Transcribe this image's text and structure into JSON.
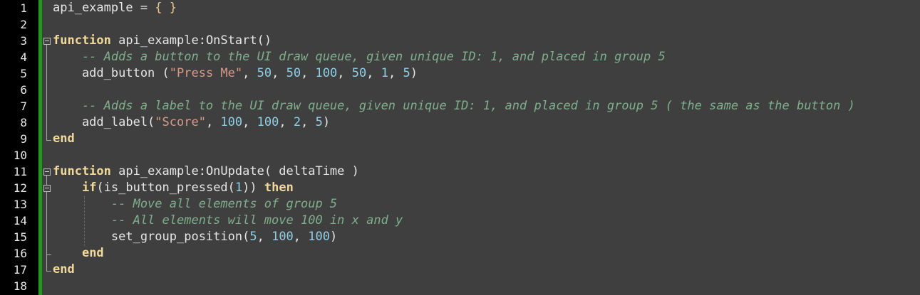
{
  "editor": {
    "lines": [
      {
        "number": "1",
        "tokens": [
          {
            "t": "id",
            "v": "api_example = "
          },
          {
            "t": "brace",
            "v": "{ }"
          }
        ]
      },
      {
        "number": "2",
        "tokens": []
      },
      {
        "number": "3",
        "tokens": [
          {
            "t": "kw",
            "v": "function"
          },
          {
            "t": "id",
            "v": " api_example:OnStart()"
          }
        ]
      },
      {
        "number": "4",
        "tokens": [
          {
            "t": "cm",
            "v": "    -- Adds a button to the UI draw queue, given unique ID: 1, and placed in group 5"
          }
        ]
      },
      {
        "number": "5",
        "tokens": [
          {
            "t": "id",
            "v": "    add_button ("
          },
          {
            "t": "st",
            "v": "\"Press Me\""
          },
          {
            "t": "id",
            "v": ", "
          },
          {
            "t": "nm",
            "v": "50"
          },
          {
            "t": "id",
            "v": ", "
          },
          {
            "t": "nm",
            "v": "50"
          },
          {
            "t": "id",
            "v": ", "
          },
          {
            "t": "nm",
            "v": "100"
          },
          {
            "t": "id",
            "v": ", "
          },
          {
            "t": "nm",
            "v": "50"
          },
          {
            "t": "id",
            "v": ", "
          },
          {
            "t": "nm",
            "v": "1"
          },
          {
            "t": "id",
            "v": ", "
          },
          {
            "t": "nm",
            "v": "5"
          },
          {
            "t": "id",
            "v": ")"
          }
        ]
      },
      {
        "number": "6",
        "tokens": []
      },
      {
        "number": "7",
        "tokens": [
          {
            "t": "cm",
            "v": "    -- Adds a label to the UI draw queue, given unique ID: 1, and placed in group 5 ( the same as the button )"
          }
        ]
      },
      {
        "number": "8",
        "tokens": [
          {
            "t": "id",
            "v": "    add_label("
          },
          {
            "t": "st",
            "v": "\"Score\""
          },
          {
            "t": "id",
            "v": ", "
          },
          {
            "t": "nm",
            "v": "100"
          },
          {
            "t": "id",
            "v": ", "
          },
          {
            "t": "nm",
            "v": "100"
          },
          {
            "t": "id",
            "v": ", "
          },
          {
            "t": "nm",
            "v": "2"
          },
          {
            "t": "id",
            "v": ", "
          },
          {
            "t": "nm",
            "v": "5"
          },
          {
            "t": "id",
            "v": ")"
          }
        ]
      },
      {
        "number": "9",
        "tokens": [
          {
            "t": "kw",
            "v": "end"
          }
        ]
      },
      {
        "number": "10",
        "tokens": []
      },
      {
        "number": "11",
        "tokens": [
          {
            "t": "kw",
            "v": "function"
          },
          {
            "t": "id",
            "v": " api_example:OnUpdate( deltaTime )"
          }
        ]
      },
      {
        "number": "12",
        "tokens": [
          {
            "t": "id",
            "v": "    "
          },
          {
            "t": "kw",
            "v": "if"
          },
          {
            "t": "id",
            "v": "(is_button_pressed("
          },
          {
            "t": "nm",
            "v": "1"
          },
          {
            "t": "id",
            "v": ")) "
          },
          {
            "t": "kw",
            "v": "then"
          }
        ]
      },
      {
        "number": "13",
        "tokens": [
          {
            "t": "cm",
            "v": "        -- Move all elements of group 5"
          }
        ]
      },
      {
        "number": "14",
        "tokens": [
          {
            "t": "cm",
            "v": "        -- All elements will move 100 in x and y"
          }
        ]
      },
      {
        "number": "15",
        "tokens": [
          {
            "t": "id",
            "v": "        set_group_position("
          },
          {
            "t": "nm",
            "v": "5"
          },
          {
            "t": "id",
            "v": ", "
          },
          {
            "t": "nm",
            "v": "100"
          },
          {
            "t": "id",
            "v": ", "
          },
          {
            "t": "nm",
            "v": "100"
          },
          {
            "t": "id",
            "v": ")"
          }
        ]
      },
      {
        "number": "16",
        "tokens": [
          {
            "t": "id",
            "v": "    "
          },
          {
            "t": "kw",
            "v": "end"
          }
        ]
      },
      {
        "number": "17",
        "tokens": [
          {
            "t": "kw",
            "v": "end"
          }
        ]
      },
      {
        "number": "18",
        "tokens": []
      }
    ]
  },
  "colors": {
    "background": "#3f3f3f",
    "gutter": "#000000",
    "change_bar": "#1f9a1f",
    "keyword": "#f0d99a",
    "comment": "#7fae8d",
    "string": "#d69a8a",
    "number": "#8fcfe6",
    "identifier": "#e6e6e6"
  }
}
